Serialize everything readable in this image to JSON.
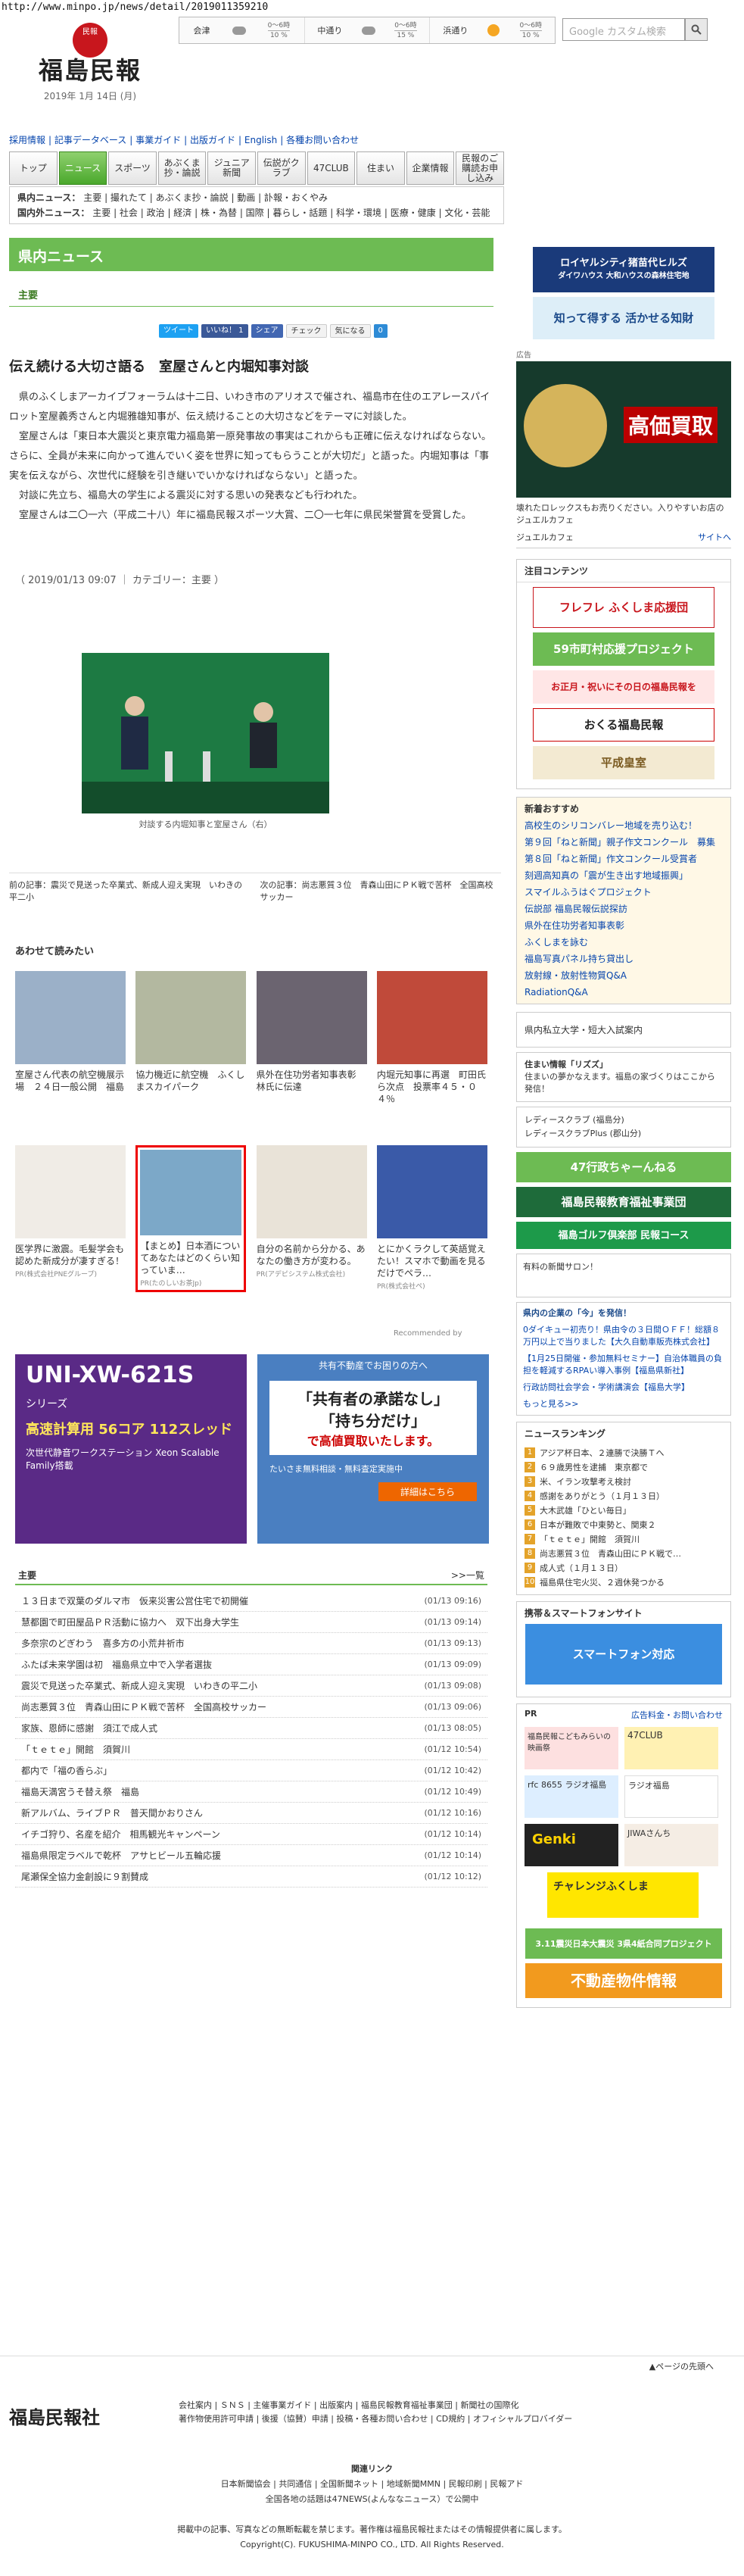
{
  "url": "http://www.minpo.jp/news/detail/2019011359210",
  "logo": {
    "emblem": "民報",
    "name": "福島民報",
    "date": "2019年 1月 14日 (月)"
  },
  "weather": [
    {
      "city": "会津",
      "top": "0〜6時",
      "pct": "10 %",
      "icon": "cloud"
    },
    {
      "city": "中通り",
      "top": "0〜6時",
      "pct": "15 %",
      "icon": "cloud"
    },
    {
      "city": "浜通り",
      "top": "0〜6時",
      "pct": "10 %",
      "icon": "sun"
    }
  ],
  "search": {
    "placeholder": "Google カスタム検索"
  },
  "util_links": [
    "採用情報",
    "記事データベース",
    "事業ガイド",
    "出版ガイド",
    "English",
    "各種お問い合わせ"
  ],
  "nav": [
    "トップ",
    "ニュース",
    "スポーツ",
    "あぶくま抄・論説",
    "ジュニア新聞",
    "伝説がクラブ",
    "47CLUB",
    "住まい",
    "企業情報",
    "民報のご購読お申し込み"
  ],
  "subnav": {
    "row1_label": "県内ニュース：",
    "row1": [
      "主要",
      "撮れたて",
      "あぶくま抄・論説",
      "動画",
      "訃報・おくやみ"
    ],
    "row2_label": "国内外ニュース：",
    "row2": [
      "主要",
      "社会",
      "政治",
      "経済",
      "株・為替",
      "国際",
      "暮らし・話題",
      "科学・環境",
      "医療・健康",
      "文化・芸能"
    ]
  },
  "section_title": "県内ニュース",
  "section_sub": "主要",
  "share": [
    "ツイート",
    "いいね！ 1",
    "シェア",
    "チェック",
    "気になる",
    "0"
  ],
  "article": {
    "title": "伝え続ける大切さ語る　室屋さんと内堀知事対談",
    "paragraphs": [
      "県のふくしまアーカイブフォーラムは十二日、いわき市のアリオスで催され、福島市在住のエアレースパイロット室屋義秀さんと内堀雅雄知事が、伝え続けることの大切さなどをテーマに対談した。",
      "室屋さんは「東日本大震災と東京電力福島第一原発事故の事実はこれからも正確に伝えなければならない。さらに、全員が未来に向かって進んでいく姿を世界に知ってもらうことが大切だ」と語った。内堀知事は「事実を伝えながら、次世代に経験を引き継いでいかなければならない」と語った。",
      "対談に先立ち、福島大の学生による震災に対する思いの発表なども行われた。",
      "室屋さんは二〇一六（平成二十八）年に福島民報スポーツ大賞、二〇一七年に県民栄誉賞を受賞した。"
    ],
    "meta": "（ 2019/01/13 09:07 ｜ カテゴリー：主要 ）",
    "caption": "対談する内堀知事と室屋さん（右）",
    "prev": "前の記事：震災で見送った卒業式、新成人迎え実現　いわきの平二小",
    "next": "次の記事：尚志悪質３位　青森山田にＰＫ戦で苦杯　全国高校サッカー"
  },
  "related": {
    "heading": "あわせて読みたい",
    "row1": [
      {
        "title": "室屋さん代表の航空機展示場　２４日一般公開　福島",
        "pr": ""
      },
      {
        "title": "協力機近に航空機　ふくしまスカイパーク",
        "pr": ""
      },
      {
        "title": "県外在住功労者知事表彰　林氏に伝達",
        "pr": ""
      },
      {
        "title": "内堀元知事に再選　町田氏ら次点　投票率４５・０４％",
        "pr": ""
      }
    ],
    "row2": [
      {
        "title": "医学界に激震。毛髪学会も認めた新成分が凄すぎる！",
        "pr": "PR(株式会社PNEグループ)"
      },
      {
        "title": "【まとめ】日本酒についてあなたはどのくらい知っていま…",
        "pr": "PR(たのしいお茶Jp)"
      },
      {
        "title": "自分の名前から分かる、あなたの働き方が変わる。",
        "pr": "PR(アデピシステム株式会社)"
      },
      {
        "title": "とにかくラクして英語覚えたい！スマホで動画を見るだけでペラ…",
        "pr": "PR(株式会社ペ)"
      }
    ],
    "recommended": "Recommended by"
  },
  "ads": {
    "ad1_title": "UNI-XW-621S",
    "ad1_sub": "シリーズ",
    "ad1_text": "高速計算用 56コア 112スレッド",
    "ad1_text2": "次世代静音ワークステーション Xeon Scalable Family搭載",
    "ad2_top": "共有不動産でお困りの方へ",
    "ad2_main1": "「共有者の承諾なし」",
    "ad2_main2": "「持ち分だけ」",
    "ad2_main3": "で高値買取いたします。",
    "ad2_bottom": "たいさま無料相談・無料査定実施中",
    "ad2_btn": "詳細はこちら"
  },
  "list": {
    "heading": "主要",
    "more": ">>一覧",
    "items": [
      {
        "t": "１３日まで双葉のダルマ市　仮来災害公営住宅で初開催",
        "d": "(01/13 09:16)"
      },
      {
        "t": "慧都園で町田屋品ＰＲ活動に協力へ　双下出身大学生",
        "d": "(01/13 09:14)"
      },
      {
        "t": "多奈宗のどぎわう　喜多方の小荒井祈市",
        "d": "(01/13 09:13)"
      },
      {
        "t": "ふたば未来学園は初　福島県立中で入学者選抜",
        "d": "(01/13 09:09)"
      },
      {
        "t": "震災で見送った卒業式、新成人迎え実現　いわきの平二小",
        "d": "(01/13 09:08)"
      },
      {
        "t": "尚志悪質３位　青森山田にＰＫ戦で苦杯　全国高校サッカー",
        "d": "(01/13 09:06)"
      },
      {
        "t": "家族、恩師に感謝　須江で成人式",
        "d": "(01/13 08:05)"
      },
      {
        "t": "「ｔｅｔｅ」開館　須賀川",
        "d": "(01/12 10:54)"
      },
      {
        "t": "都内で「福の香らぶ」",
        "d": "(01/12 10:42)"
      },
      {
        "t": "福島天満宮うそ替え祭　福島",
        "d": "(01/12 10:49)"
      },
      {
        "t": "新アルバム、ライブＰＲ　普天間かおりさん",
        "d": "(01/12 10:16)"
      },
      {
        "t": "イチゴ狩り、名産を紹介　相馬観光キャンペーン",
        "d": "(01/12 10:14)"
      },
      {
        "t": "福島県限定ラベルで乾杯　アサヒビール五輪応援",
        "d": "(01/12 10:14)"
      },
      {
        "t": "尾瀬保全協力金創設に９割賛成",
        "d": "(01/12 10:12)"
      }
    ]
  },
  "side": {
    "banner1a": "ロイヤルシティ猪苗代ヒルズ",
    "banner1b": "ダイワハウス 大和ハウスの森林住宅地",
    "banner2": "知って得する 活かせる知財",
    "ad_label": "広告",
    "rolex_text": "壊れたロレックスもお売りください。入りやすいお店のジュエルカフェ",
    "rolex_big": "高価買取",
    "rolex_shop": "ジュエルカフェ",
    "rolex_site": "サイトへ",
    "attention_h": "注目コンテンツ",
    "attn": [
      "フレフレ ふくしま応援団",
      "59市町村応援プロジェクト",
      "おくる福島民報",
      "平成皇室",
      "お正月・祝いにその日の福島民報を",
      "お申し込み"
    ],
    "topics_h": "新着おすすめ",
    "topics": [
      "高校生のシリコンバレー地域を売り込む！",
      "第９回「ねと新聞」親子作文コンクール　募集",
      "第８回「ねと新聞」作文コンクール受賞者",
      "刻週高知真の「震が生き出す地域振興」",
      "スマイルふうはぐプロジェクト",
      "伝説部 福島民報伝説探訪",
      "県外在住功労者知事表彰",
      "ふくしまを詠む",
      "福島写真パネル持ち貸出し",
      "放射線・放射性物質Q&A",
      "RadiationQ&A"
    ],
    "univ": "県内私立大学・短大入試案内",
    "lives_h": "住まい情報「リズズ」",
    "lives_t": "住まいの夢かなえます。福島の家づくりはここから発信！",
    "ladies": "レディースクラブ (福島分)",
    "ladies2": "レディースクラブPlus (郡山分)",
    "channel": "47行政ちゃーんねる",
    "edu": "福島民報教育福祉事業団",
    "golf": "福島ゴルフ倶楽部 民報コース",
    "golf_sub": "有料の新聞サロン！",
    "press_h": "県内の企業の「今」を発信！",
    "press": [
      "0ダイキュー初売り！県由令の３日間ＯＦＦ！総額８万円以上で当りました【大久自動車販売株式会社】",
      "【1月25日開催・参加無料セミナー】自治体職員の負担を軽減するRPAい導入事例【福島県新社】",
      "行政訪問社会学会・学術講演会【福島大学】"
    ],
    "press_more": "もっと見る>>",
    "rank_h": "ニュースランキング",
    "rank": [
      "アジア杯日本、２連勝で決勝Ｔへ",
      "６９歳男性を逮捕　東京都で",
      "米、イラン攻撃考え検討",
      "感謝をありがとう（１月１３日）",
      "大木武雄「ひとい毎日」",
      "日本が難敗で中東勢と、関東２",
      "「ｔｅｔｅ」開館　須賀川",
      "尚志悪質３位　青森山田にＰＫ戦で…",
      "成人式（１月１３日）",
      "福島県住宅火災、２週休発つかる"
    ],
    "mobile_h": "携帯＆スマートフォンサイト",
    "smart": "スマートフォン対応",
    "pr_h": "PR",
    "pr_more": "広告料金・お問い合わせ",
    "pr_items": [
      "福島民報こどもみらいの映画祭",
      "47CLUB",
      "rfc 8655 ラジオ福島",
      "ラジオ福島",
      "Genki",
      "JIWAさんち",
      "チャレンジふくしま"
    ],
    "project": "3.11震災日本大震災 3県4紙合同プロジェクト",
    "fudosan": "不動産物件情報"
  },
  "footer": {
    "top": "▲ページの先頭へ",
    "logo": "福島民報社",
    "links1": [
      "会社案内",
      "ＳＮＳ",
      "主催事業ガイド",
      "出版案内",
      "福島民報教育福祉事業団",
      "新聞社の国際化"
    ],
    "links2": [
      "著作物使用許可申請",
      "後援（協賛）申請",
      "投稿・各種お問い合わせ",
      "CD規約",
      "オフィシャルプロバイダー"
    ],
    "related_h": "関連リンク",
    "related": [
      "日本新聞協会",
      "共同通信",
      "全国新聞ネット",
      "地域新聞MMN",
      "民報印刷",
      "民報アド"
    ],
    "line3": "全国各地の話題は47NEWS(よんななニュース）で公開中",
    "notice": "掲載中の記事、写真などの無断転載を禁じます。著作権は福島民報社またはその情報提供者に属します。",
    "copyright": "Copyright(C). FUKUSHIMA-MINPO CO., LTD. All Rights Reserved."
  },
  "colors": {
    "green": "#6dbb53",
    "red": "#c8161d"
  }
}
